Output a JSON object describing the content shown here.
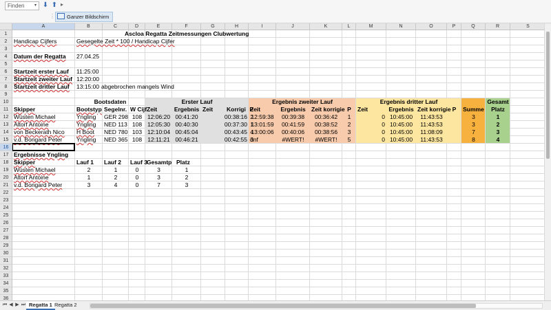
{
  "toolbar": {
    "find_placeholder": "Finden",
    "find_dropdown": "▾",
    "find_down": "⬇",
    "find_up": "⬆",
    "separator": "▸",
    "fullscreen_label": "Ganzer Bildschirm"
  },
  "columns": [
    "A",
    "B",
    "C",
    "D",
    "E",
    "F",
    "G",
    "H",
    "I",
    "J",
    "K",
    "L",
    "M",
    "N",
    "O",
    "P",
    "Q",
    "R",
    "S"
  ],
  "selected_column": "A",
  "selected_row": 16,
  "rows": [
    1,
    2,
    3,
    4,
    5,
    6,
    7,
    8,
    9,
    10,
    11,
    12,
    13,
    14,
    15,
    16,
    17,
    18,
    19,
    20,
    21,
    22,
    23,
    24,
    25,
    26,
    27,
    28,
    29,
    30,
    31,
    32,
    33,
    34,
    35,
    36
  ],
  "sheet": {
    "title": "Ascloa Regatta Zeitmessungen Clubwertung",
    "handicap_label": "Handicap Cijfers",
    "formula_text": "Gesegelte Zeit * 100 / Handicap Cijfer",
    "date_label": "Datum der Regatta",
    "date_value": "27.04.25",
    "start1_label": "Startzeit erster Lauf",
    "start1_value": "11:25:00",
    "start2_label": "Startzeit zweiter Lauf",
    "start2_value": "12:20:00",
    "start3_label": "Startzeit dritter Lauf",
    "start3_value": "13:15:00",
    "start3_note": "abgebrochen mangels Wind"
  },
  "groups": {
    "bootsdaten": "Bootsdaten",
    "erster_lauf": "Erster Lauf",
    "ergebnis_zweiter": "Ergebnis zweiter Lauf",
    "ergebnis_dritter": "Ergebnis dritter Lauf",
    "gesamt": "Gesamt"
  },
  "headers": {
    "skipper": "Skipper",
    "bootstyp": "Bootstyp",
    "segelnr": "Segelnr.",
    "cijfer": "W Cijf",
    "zeit": "Zeit",
    "ergebnis": "Ergebnis",
    "zeit2": "Zeit",
    "korrigiert": "Korrigi",
    "p": "P",
    "zeit_korrigiert": "Zeit korrigie",
    "summe": "Summe",
    "platz": "Platz"
  },
  "results": [
    {
      "skipper": "Wüsten Michael",
      "typ": "Yngling",
      "segelnr": "GER 298",
      "cijfer": "108",
      "z1": "12:06:20",
      "e1": "00:41:20",
      "k1": "00:38:16",
      "p1": "2",
      "z2": "12:59:38",
      "e2": "00:39:38",
      "k2": "00:36:42",
      "p2": "1",
      "z3": "0",
      "e3": "10:45:00",
      "k3": "11:43:53",
      "p3": "",
      "summe": "3",
      "platz": "1"
    },
    {
      "skipper": "Altorf Antoine",
      "typ": "Yngling",
      "segelnr": "NED 113",
      "cijfer": "108",
      "z1": "12:05:30",
      "e1": "00:40:30",
      "k1": "00:37:30",
      "p1": "1",
      "z2": "13:01:59",
      "e2": "00:41:59",
      "k2": "00:38:52",
      "p2": "2",
      "z3": "0",
      "e3": "10:45:00",
      "k3": "11:43:53",
      "p3": "",
      "summe": "3",
      "platz": "2"
    },
    {
      "skipper": "von Beckerath Nico",
      "typ": "H Boot",
      "segelnr": "NED 780",
      "cijfer": "103",
      "z1": "12:10:04",
      "e1": "00:45:04",
      "k1": "00:43:45",
      "p1": "4",
      "z2": "13:00:06",
      "e2": "00:40:06",
      "k2": "00:38:56",
      "p2": "3",
      "z3": "0",
      "e3": "10:45:00",
      "k3": "11:08:09",
      "p3": "",
      "summe": "7",
      "platz": "3"
    },
    {
      "skipper": "v.d. Bongard Peter",
      "typ": "Yngling",
      "segelnr": "NED 365",
      "cijfer": "108",
      "z1": "12:11:21",
      "e1": "00:46:21",
      "k1": "00:42:55",
      "p1": "3",
      "z2": "dnf",
      "e2": "#WERT!",
      "k2": "#WERT!",
      "p2": "5",
      "z3": "0",
      "e3": "10:45:00",
      "k3": "11:43:53",
      "p3": "",
      "summe": "8",
      "platz": "4"
    }
  ],
  "yngling": {
    "title": "Ergebnisse Yngling",
    "headers": {
      "skipper": "Skipper",
      "lauf1": "Lauf 1",
      "lauf2": "Lauf 2",
      "lauf3": "Lauf 3",
      "gesamtp": "Gesamtp",
      "platz": "Platz"
    },
    "rows": [
      {
        "skipper": "Wüsten Michael",
        "l1": "2",
        "l2": "1",
        "l3": "0",
        "g": "3",
        "p": "1"
      },
      {
        "skipper": "Altorf Antoine",
        "l1": "1",
        "l2": "2",
        "l3": "0",
        "g": "3",
        "p": "2"
      },
      {
        "skipper": "v.d. Bongard Peter",
        "l1": "3",
        "l2": "4",
        "l3": "0",
        "g": "7",
        "p": "3"
      }
    ]
  },
  "tabs": [
    "Regatta 1",
    "Regatta 2"
  ],
  "colors": {
    "grey_band": "#e0e0e0",
    "salmon_band": "#f7cbac",
    "yellow_band": "#fde6a0",
    "orange_band": "#f7b13f",
    "green_band": "#a9d18e"
  }
}
